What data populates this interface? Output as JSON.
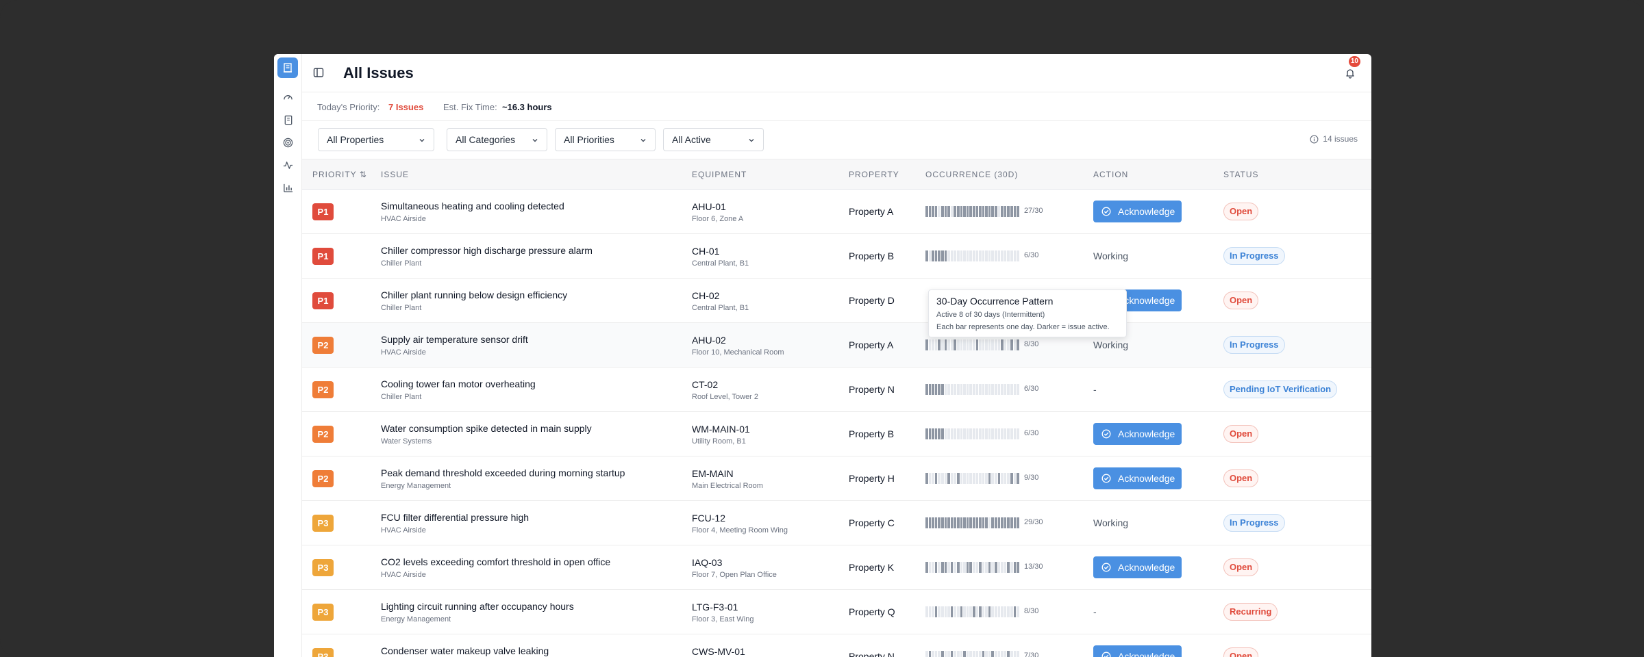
{
  "header": {
    "title": "All Issues",
    "notification_count": "10"
  },
  "summary": {
    "priority_label": "Today's Priority:",
    "priority_value": "7 Issues",
    "fix_label": "Est. Fix Time:",
    "fix_value": "~16.3 hours"
  },
  "filters": {
    "property": "All Properties",
    "category": "All Categories",
    "priority": "All Priorities",
    "active": "All Active",
    "issue_count": "14 issues"
  },
  "columns": {
    "priority": "PRIORITY ⇅",
    "issue": "ISSUE",
    "equipment": "EQUIPMENT",
    "property": "PROPERTY",
    "occurrence": "OCCURRENCE (30D)",
    "action": "ACTION",
    "status": "STATUS"
  },
  "ack_label": "Acknowledge",
  "colors": {
    "p1": "#e04b3c",
    "p2": "#ef7d38",
    "p3": "#eea63a",
    "accent": "#4a90e2",
    "occ_active": "#8e96a3",
    "occ_inactive": "#e6e9ee"
  },
  "tooltip": {
    "title": "30-Day Occurrence Pattern",
    "line1": "Active 8 of 30 days (Intermittent)",
    "line2": "Each bar represents one day. Darker = issue active."
  },
  "rows": [
    {
      "priority": "P1",
      "title": "Simultaneous heating and cooling detected",
      "category": "HVAC Airside",
      "equipment": "AHU-01",
      "location": "Floor 6, Zone A",
      "property": "Property A",
      "occ_days": [
        1,
        1,
        1,
        1,
        0,
        1,
        1,
        1,
        0,
        1,
        1,
        1,
        1,
        1,
        1,
        1,
        1,
        1,
        1,
        1,
        1,
        1,
        1,
        0,
        1,
        1,
        1,
        1,
        1,
        1
      ],
      "occurrence": "27/30",
      "action": "Acknowledge",
      "action_type": "button",
      "status": "Open",
      "status_type": "open"
    },
    {
      "priority": "P1",
      "title": "Chiller compressor high discharge pressure alarm",
      "category": "Chiller Plant",
      "equipment": "CH-01",
      "location": "Central Plant, B1",
      "property": "Property B",
      "occ_days": [
        1,
        0,
        1,
        1,
        1,
        1,
        1,
        0,
        0,
        0,
        0,
        0,
        0,
        0,
        0,
        0,
        0,
        0,
        0,
        0,
        0,
        0,
        0,
        0,
        0,
        0,
        0,
        0,
        0,
        0
      ],
      "occurrence": "6/30",
      "action": "Working",
      "action_type": "text",
      "status": "In Progress",
      "status_type": "progress"
    },
    {
      "priority": "P1",
      "title": "Chiller plant running below design efficiency",
      "category": "Chiller Plant",
      "equipment": "CH-02",
      "location": "Central Plant, B1",
      "property": "Property D",
      "occ_days": [
        0,
        0,
        0,
        0,
        0,
        0,
        0,
        0,
        0,
        0,
        0,
        0,
        0,
        0,
        0,
        0,
        0,
        0,
        0,
        0,
        0,
        0,
        0,
        0,
        0,
        0,
        0,
        0,
        0,
        0
      ],
      "occurrence": "",
      "action": "Acknowledge",
      "action_type": "button",
      "status": "Open",
      "status_type": "open"
    },
    {
      "priority": "P2",
      "title": "Supply air temperature sensor drift",
      "category": "HVAC Airside",
      "equipment": "AHU-02",
      "location": "Floor 10, Mechanical Room",
      "property": "Property A",
      "occ_days": [
        1,
        0,
        0,
        0,
        1,
        0,
        1,
        0,
        0,
        1,
        0,
        0,
        0,
        0,
        0,
        0,
        1,
        0,
        0,
        0,
        0,
        0,
        0,
        0,
        1,
        0,
        0,
        1,
        0,
        1
      ],
      "occurrence": "8/30",
      "action": "Working",
      "action_type": "text",
      "status": "In Progress",
      "status_type": "progress"
    },
    {
      "priority": "P2",
      "title": "Cooling tower fan motor overheating",
      "category": "Chiller Plant",
      "equipment": "CT-02",
      "location": "Roof Level, Tower 2",
      "property": "Property N",
      "occ_days": [
        1,
        1,
        1,
        1,
        1,
        1,
        0,
        0,
        0,
        0,
        0,
        0,
        0,
        0,
        0,
        0,
        0,
        0,
        0,
        0,
        0,
        0,
        0,
        0,
        0,
        0,
        0,
        0,
        0,
        0
      ],
      "occurrence": "6/30",
      "action": "-",
      "action_type": "text",
      "status": "Pending IoT Verification",
      "status_type": "progress"
    },
    {
      "priority": "P2",
      "title": "Water consumption spike detected in main supply",
      "category": "Water Systems",
      "equipment": "WM-MAIN-01",
      "location": "Utility Room, B1",
      "property": "Property B",
      "occ_days": [
        1,
        1,
        1,
        1,
        1,
        1,
        0,
        0,
        0,
        0,
        0,
        0,
        0,
        0,
        0,
        0,
        0,
        0,
        0,
        0,
        0,
        0,
        0,
        0,
        0,
        0,
        0,
        0,
        0,
        0
      ],
      "occurrence": "6/30",
      "action": "Acknowledge",
      "action_type": "button",
      "status": "Open",
      "status_type": "open"
    },
    {
      "priority": "P2",
      "title": "Peak demand threshold exceeded during morning startup",
      "category": "Energy Management",
      "equipment": "EM-MAIN",
      "location": "Main Electrical Room",
      "property": "Property H",
      "occ_days": [
        1,
        0,
        0,
        1,
        0,
        0,
        0,
        1,
        0,
        0,
        1,
        0,
        0,
        0,
        0,
        0,
        0,
        0,
        0,
        0,
        1,
        0,
        0,
        1,
        0,
        0,
        0,
        1,
        0,
        1
      ],
      "occurrence": "9/30",
      "action": "Acknowledge",
      "action_type": "button",
      "status": "Open",
      "status_type": "open"
    },
    {
      "priority": "P3",
      "title": "FCU filter differential pressure high",
      "category": "HVAC Airside",
      "equipment": "FCU-12",
      "location": "Floor 4, Meeting Room Wing",
      "property": "Property C",
      "occ_days": [
        1,
        1,
        1,
        1,
        1,
        1,
        1,
        1,
        1,
        1,
        1,
        1,
        1,
        1,
        1,
        1,
        1,
        1,
        1,
        1,
        0,
        1,
        1,
        1,
        1,
        1,
        1,
        1,
        1,
        1
      ],
      "occurrence": "29/30",
      "action": "Working",
      "action_type": "text",
      "status": "In Progress",
      "status_type": "progress"
    },
    {
      "priority": "P3",
      "title": "CO2 levels exceeding comfort threshold in open office",
      "category": "HVAC Airside",
      "equipment": "IAQ-03",
      "location": "Floor 7, Open Plan Office",
      "property": "Property K",
      "occ_days": [
        1,
        0,
        0,
        1,
        0,
        1,
        1,
        0,
        1,
        0,
        1,
        0,
        0,
        1,
        1,
        0,
        0,
        1,
        0,
        0,
        1,
        0,
        1,
        0,
        0,
        0,
        1,
        0,
        1,
        1
      ],
      "occurrence": "13/30",
      "action": "Acknowledge",
      "action_type": "button",
      "status": "Open",
      "status_type": "open"
    },
    {
      "priority": "P3",
      "title": "Lighting circuit running after occupancy hours",
      "category": "Energy Management",
      "equipment": "LTG-F3-01",
      "location": "Floor 3, East Wing",
      "property": "Property Q",
      "occ_days": [
        0,
        0,
        0,
        1,
        0,
        0,
        0,
        0,
        1,
        0,
        0,
        1,
        0,
        0,
        0,
        1,
        0,
        1,
        0,
        0,
        1,
        0,
        0,
        0,
        0,
        0,
        0,
        0,
        1,
        0
      ],
      "occurrence": "8/30",
      "action": "-",
      "action_type": "text",
      "status": "Recurring",
      "status_type": "recurring"
    },
    {
      "priority": "P3",
      "title": "Condenser water makeup valve leaking",
      "category": "",
      "equipment": "CWS-MV-01",
      "location": "",
      "property": "Property N",
      "occ_days": [
        0,
        1,
        0,
        0,
        0,
        1,
        0,
        0,
        1,
        0,
        0,
        0,
        1,
        0,
        0,
        0,
        0,
        0,
        1,
        0,
        0,
        1,
        0,
        0,
        0,
        0,
        1,
        0,
        0,
        0
      ],
      "occurrence": "7/30",
      "action": "Acknowledge",
      "action_type": "button",
      "status": "Open",
      "status_type": "open"
    }
  ]
}
